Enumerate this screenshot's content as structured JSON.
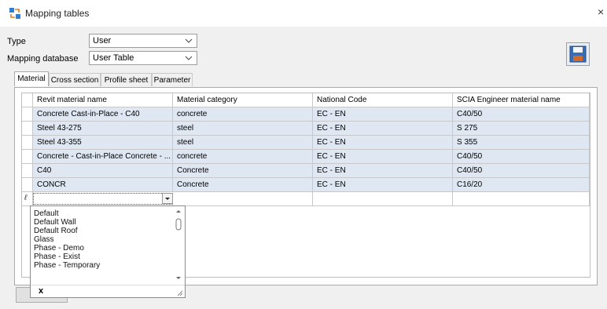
{
  "window": {
    "title": "Mapping tables",
    "close": "×"
  },
  "form": {
    "type_label": "Type",
    "type_value": "User",
    "db_label": "Mapping database",
    "db_value": "User Table"
  },
  "tabs": [
    {
      "label": "Material",
      "active": true
    },
    {
      "label": "Cross section",
      "active": false
    },
    {
      "label": "Profile sheet",
      "active": false
    },
    {
      "label": "Parameter",
      "active": false
    }
  ],
  "table": {
    "columns": [
      "Revit material name",
      "Material category",
      "National Code",
      "SCIA Engineer material name"
    ],
    "rows": [
      [
        "Concrete Cast-in-Place - C40",
        "concrete",
        "EC - EN",
        "C40/50"
      ],
      [
        "Steel 43-275",
        "steel",
        "EC - EN",
        "S 275"
      ],
      [
        "Steel 43-355",
        "steel",
        "EC - EN",
        "S 355"
      ],
      [
        "Concrete - Cast-in-Place Concrete - ...",
        "concrete",
        "EC - EN",
        "C40/50"
      ],
      [
        "C40",
        "Concrete",
        "EC - EN",
        "C40/50"
      ],
      [
        "CONCR",
        "Concrete",
        "EC - EN",
        "C16/20"
      ]
    ],
    "new_row_marker": "ℓ"
  },
  "dropdown": {
    "items": [
      "Default",
      "Default Wall",
      "Default Roof",
      "Glass",
      "Phase - Demo",
      "Phase - Exist",
      "Phase - Temporary"
    ],
    "clear_label": "x"
  },
  "colors": {
    "row_bg": "#dfe7f2",
    "border": "#c8c8c8"
  }
}
